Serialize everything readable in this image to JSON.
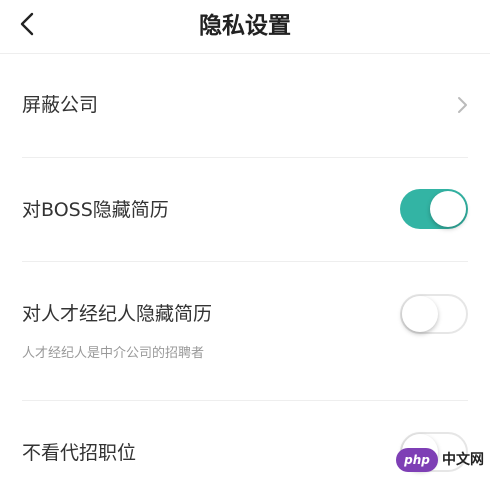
{
  "nav": {
    "title": "隐私设置",
    "back_icon": "chevron-left-icon"
  },
  "settings": {
    "block_companies": {
      "label": "屏蔽公司",
      "icon": "chevron-right-icon"
    },
    "hide_from_boss": {
      "label": "对BOSS隐藏简历",
      "enabled": true
    },
    "hide_from_agents": {
      "label": "对人才经纪人隐藏简历",
      "description": "人才经纪人是中介公司的招聘者",
      "enabled": false
    },
    "hide_proxy_jobs": {
      "label": "不看代招职位",
      "enabled": false
    }
  },
  "colors": {
    "accent": "#33b4a4",
    "divider": "#eeeeee",
    "secondary_text": "#999999"
  },
  "watermark": {
    "logo": "php",
    "text": "中文网"
  }
}
